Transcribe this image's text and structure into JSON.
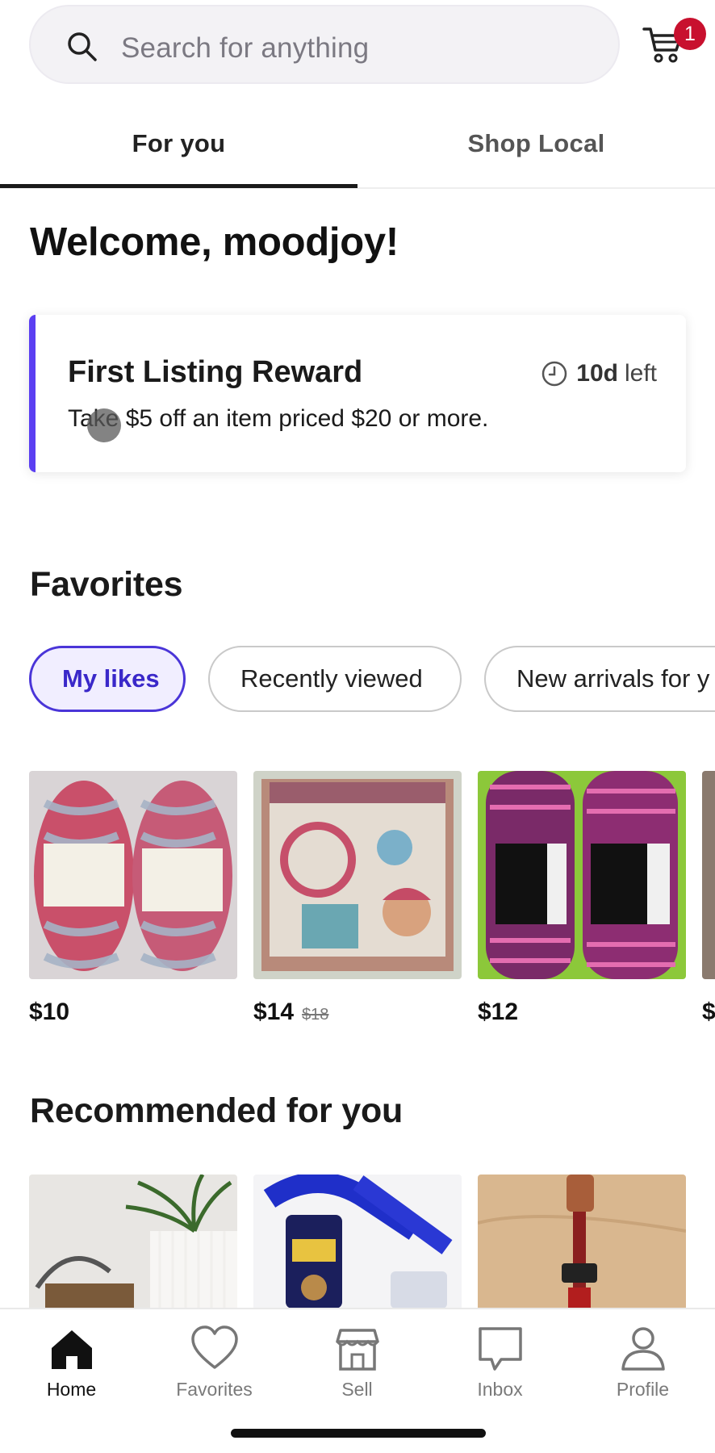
{
  "search": {
    "placeholder": "Search for anything",
    "icon": "search-icon"
  },
  "cart": {
    "icon": "cart-icon",
    "badge_count": "1",
    "badge_color": "#c8102e"
  },
  "tabs": [
    {
      "label": "For you",
      "active": true
    },
    {
      "label": "Shop Local",
      "active": false
    }
  ],
  "welcome": {
    "text": "Welcome, moodjoy!"
  },
  "reward": {
    "title": "First Listing Reward",
    "description": "Take $5 off an item priced $20 or more.",
    "time_value": "10d",
    "time_suffix": "left",
    "icon": "clock-icon",
    "accent_color": "#5b3ff2"
  },
  "favorites": {
    "title": "Favorites",
    "chips": [
      {
        "label": "My likes",
        "active": true
      },
      {
        "label": "Recently viewed",
        "active": false
      },
      {
        "label": "New arrivals for y",
        "active": false
      }
    ],
    "products": [
      {
        "price": "$10",
        "original_price": ""
      },
      {
        "price": "$14",
        "original_price": "$18"
      },
      {
        "price": "$12",
        "original_price": ""
      },
      {
        "price": "$",
        "original_price": ""
      }
    ]
  },
  "recommended": {
    "title": "Recommended for you"
  },
  "bottom_nav": [
    {
      "label": "Home",
      "icon": "home-icon",
      "active": true
    },
    {
      "label": "Favorites",
      "icon": "heart-icon",
      "active": false
    },
    {
      "label": "Sell",
      "icon": "shop-icon",
      "active": false
    },
    {
      "label": "Inbox",
      "icon": "chat-icon",
      "active": false
    },
    {
      "label": "Profile",
      "icon": "person-icon",
      "active": false
    }
  ]
}
